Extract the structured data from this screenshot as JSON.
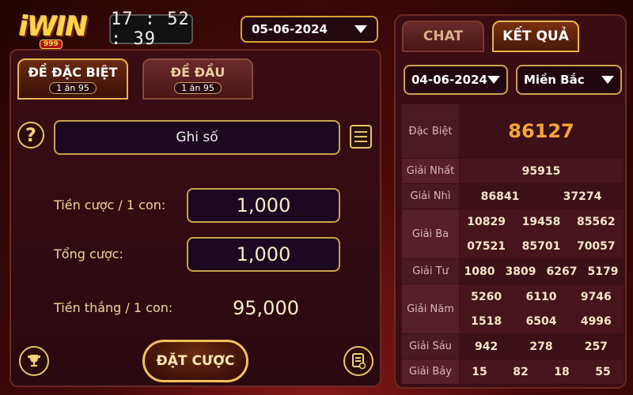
{
  "header": {
    "logo_text": "iWIN",
    "logo_sub": "999",
    "clock": "17 : 52 : 39",
    "date": "05-06-2024"
  },
  "left": {
    "tabs": [
      {
        "label": "ĐỀ ĐẶC BIỆT",
        "badge": "1 ăn 95"
      },
      {
        "label": "ĐỀ ĐẦU",
        "badge": "1 ăn 95"
      }
    ],
    "help_label": "?",
    "note_field": "Ghi số",
    "bet_per_label": "Tiền cược / 1 con:",
    "bet_per_value": "1,000",
    "total_label": "Tổng cược:",
    "total_value": "1,000",
    "win_label": "Tiền thắng / 1 con:",
    "win_value": "95,000",
    "bet_button": "ĐẶT CƯỢC"
  },
  "right": {
    "tabs": [
      "CHAT",
      "KẾT QUẢ"
    ],
    "date": "04-06-2024",
    "region": "Miền Bắc",
    "results": [
      {
        "label": "Đặc Biệt",
        "lines": [
          [
            "86127"
          ]
        ]
      },
      {
        "label": "Giải Nhất",
        "lines": [
          [
            "95915"
          ]
        ]
      },
      {
        "label": "Giải Nhì",
        "lines": [
          [
            "86841",
            "37274"
          ]
        ]
      },
      {
        "label": "Giải Ba",
        "lines": [
          [
            "10829",
            "19458",
            "85562"
          ],
          [
            "07521",
            "85701",
            "70057"
          ]
        ]
      },
      {
        "label": "Giải Tư",
        "lines": [
          [
            "1080",
            "3809",
            "6267",
            "5179"
          ]
        ]
      },
      {
        "label": "Giải Năm",
        "lines": [
          [
            "5260",
            "6110",
            "9746"
          ],
          [
            "1518",
            "6504",
            "4996"
          ]
        ]
      },
      {
        "label": "Giải Sáu",
        "lines": [
          [
            "942",
            "278",
            "257"
          ]
        ]
      },
      {
        "label": "Giải Bảy",
        "lines": [
          [
            "15",
            "82",
            "18",
            "55"
          ]
        ]
      }
    ]
  },
  "colors": {
    "accent_gold": "#e8b64a",
    "special_prize": "#f6a43a"
  }
}
